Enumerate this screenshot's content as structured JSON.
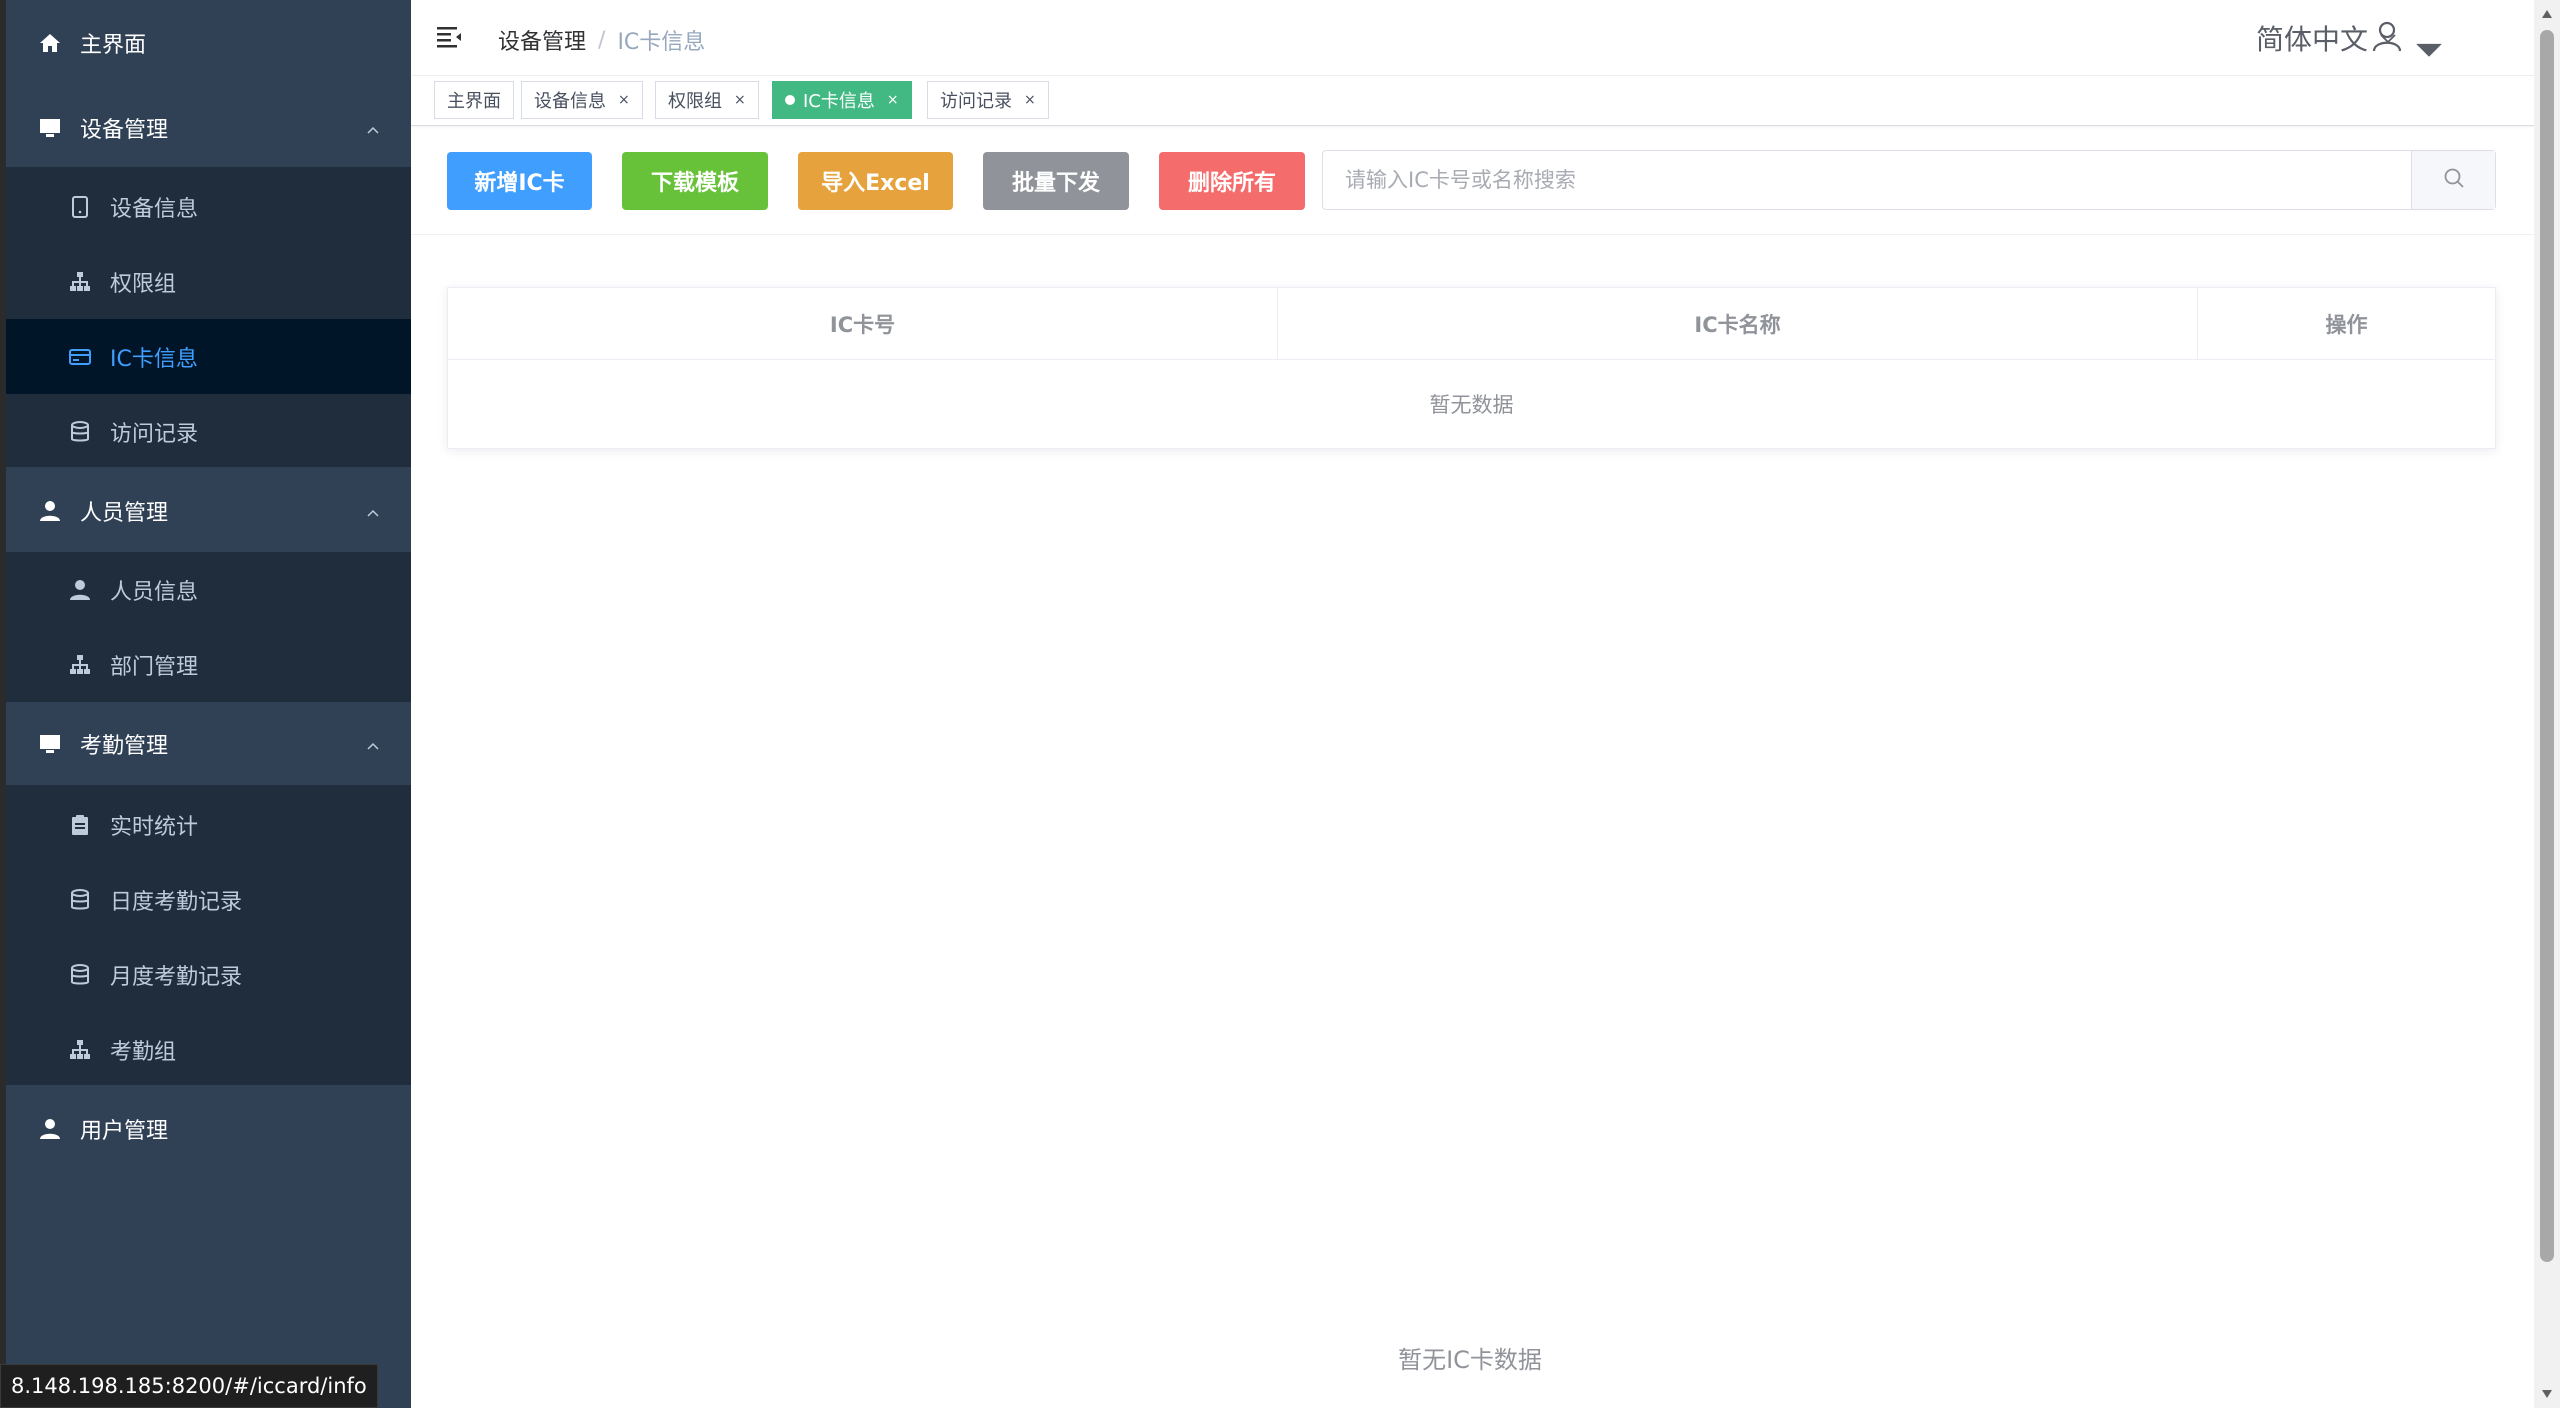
{
  "sidebar": {
    "home": {
      "label": "主界面",
      "icon": "home-icon"
    },
    "device_mgmt": {
      "label": "设备管理",
      "icon": "monitor-icon",
      "items": [
        {
          "label": "设备信息",
          "icon": "tablet-icon"
        },
        {
          "label": "权限组",
          "icon": "org-tree-icon"
        },
        {
          "label": "IC卡信息",
          "icon": "card-icon",
          "active": true
        },
        {
          "label": "访问记录",
          "icon": "database-icon"
        }
      ]
    },
    "person_mgmt": {
      "label": "人员管理",
      "icon": "user-icon",
      "items": [
        {
          "label": "人员信息",
          "icon": "user-icon"
        },
        {
          "label": "部门管理",
          "icon": "org-tree-icon"
        }
      ]
    },
    "attendance_mgmt": {
      "label": "考勤管理",
      "icon": "monitor-icon",
      "items": [
        {
          "label": "实时统计",
          "icon": "clipboard-icon"
        },
        {
          "label": "日度考勤记录",
          "icon": "database-icon"
        },
        {
          "label": "月度考勤记录",
          "icon": "database-icon"
        },
        {
          "label": "考勤组",
          "icon": "org-tree-icon"
        }
      ]
    },
    "user_mgmt": {
      "label": "用户管理",
      "icon": "user-icon"
    }
  },
  "navbar": {
    "breadcrumb": [
      "设备管理",
      "IC卡信息"
    ],
    "breadcrumb_separator": "/",
    "language": "简体中文"
  },
  "tags": [
    {
      "label": "主界面",
      "closable": false,
      "active": false
    },
    {
      "label": "设备信息",
      "closable": true,
      "active": false
    },
    {
      "label": "权限组",
      "closable": true,
      "active": false
    },
    {
      "label": "IC卡信息",
      "closable": true,
      "active": true
    },
    {
      "label": "访问记录",
      "closable": true,
      "active": false
    }
  ],
  "tag_close_glyph": "×",
  "toolbar": {
    "add_label": "新增IC卡",
    "download_label": "下载模板",
    "import_label": "导入Excel",
    "batch_label": "批量下发",
    "delete_all_label": "删除所有",
    "search_placeholder": "请输入IC卡号或名称搜索",
    "search_value": ""
  },
  "table": {
    "columns": [
      "IC卡号",
      "IC卡名称",
      "操作"
    ],
    "rows": [],
    "empty_text": "暂无数据"
  },
  "footer_empty_text": "暂无IC卡数据",
  "status_url": "8.148.198.185:8200/#/iccard/info",
  "colors": {
    "sidebar_bg": "#304156",
    "submenu_bg": "#1f2d3d",
    "active_menu_bg": "#001528",
    "active_menu_text": "#409eff",
    "active_tag": "#42b983",
    "btn_blue": "#409eff",
    "btn_green": "#67c23a",
    "btn_orange": "#e6a23c",
    "btn_gray": "#909399",
    "btn_red": "#f56c6c"
  }
}
